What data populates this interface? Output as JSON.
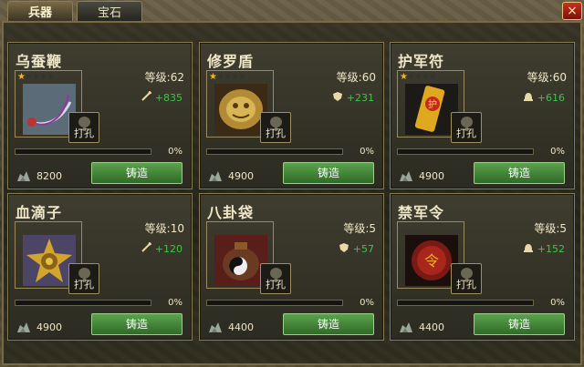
{
  "tabs": [
    {
      "label": "兵器",
      "active": true
    },
    {
      "label": "宝石",
      "active": false
    }
  ],
  "close_label": "×",
  "colors": {
    "bonus_green": "#3fc44a",
    "star_gold": "#f2b51c",
    "button_green": "#4a8f3e"
  },
  "cards": [
    {
      "name": "乌蚕鞭",
      "level_label": "等级:62",
      "bonus_icon": "sword-icon",
      "bonus": "+835",
      "punch_label": "打孔",
      "progress": "0%",
      "progress_value": 0,
      "cost": "8200",
      "forge_label": "铸造",
      "stars_on": 1,
      "stars_total": 5,
      "art": "whip"
    },
    {
      "name": "修罗盾",
      "level_label": "等级:60",
      "bonus_icon": "shield-icon",
      "bonus": "+231",
      "punch_label": "打孔",
      "progress": "0%",
      "progress_value": 0,
      "cost": "4900",
      "forge_label": "铸造",
      "stars_on": 1,
      "stars_total": 5,
      "art": "shield"
    },
    {
      "name": "护军符",
      "level_label": "等级:60",
      "bonus_icon": "helmet-icon",
      "bonus": "+616",
      "punch_label": "打孔",
      "progress": "0%",
      "progress_value": 0,
      "cost": "4900",
      "forge_label": "铸造",
      "stars_on": 1,
      "stars_total": 5,
      "art": "talisman"
    },
    {
      "name": "血滴子",
      "level_label": "等级:10",
      "bonus_icon": "sword-icon",
      "bonus": "+120",
      "punch_label": "打孔",
      "progress": "0%",
      "progress_value": 0,
      "cost": "4900",
      "forge_label": "铸造",
      "stars_on": 0,
      "stars_total": 0,
      "art": "star"
    },
    {
      "name": "八卦袋",
      "level_label": "等级:5",
      "bonus_icon": "shield-icon",
      "bonus": "+57",
      "punch_label": "打孔",
      "progress": "0%",
      "progress_value": 0,
      "cost": "4400",
      "forge_label": "铸造",
      "stars_on": 0,
      "stars_total": 0,
      "art": "bagua"
    },
    {
      "name": "禁军令",
      "level_label": "等级:5",
      "bonus_icon": "helmet-icon",
      "bonus": "+152",
      "punch_label": "打孔",
      "progress": "0%",
      "progress_value": 0,
      "cost": "4400",
      "forge_label": "铸造",
      "stars_on": 0,
      "stars_total": 0,
      "art": "token"
    }
  ]
}
